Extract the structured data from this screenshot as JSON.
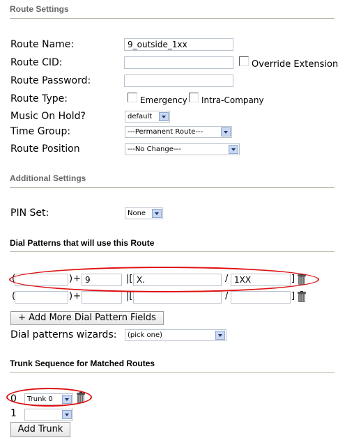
{
  "route_settings": {
    "heading": "Route Settings",
    "route_name_label": "Route Name:",
    "route_name_value": "9_outside_1xx",
    "route_cid_label": "Route CID:",
    "override_extension_label": "Override Extension",
    "route_password_label": "Route Password:",
    "route_type_label": "Route Type:",
    "emergency_label": "Emergency",
    "intra_company_label": "Intra-Company",
    "music_on_hold_label": "Music On Hold?",
    "music_on_hold_value": "default",
    "time_group_label": "Time Group:",
    "time_group_value": "---Permanent Route---",
    "route_position_label": "Route Position",
    "route_position_value": "---No Change---"
  },
  "additional_settings": {
    "heading": "Additional Settings",
    "pin_set_label": "PIN Set:",
    "pin_set_value": "None"
  },
  "dial_patterns": {
    "heading": "Dial Patterns that will use this Route",
    "rows": [
      {
        "prepend": "",
        "prefix": "9",
        "match": "X.",
        "callerid": "1XX"
      },
      {
        "prepend": "",
        "prefix": "",
        "match": "",
        "callerid": ""
      }
    ],
    "plus_sign": "+",
    "pipe_bracket": "|[",
    "slash": "/",
    "close_bracket": "]",
    "open_paren": "(",
    "close_paren": ")",
    "add_more_button": "+ Add More Dial Pattern Fields",
    "wizards_label": "Dial patterns wizards:",
    "wizards_value": "(pick one)"
  },
  "trunk_sequence": {
    "heading": "Trunk Sequence for Matched Routes",
    "rows": [
      {
        "index": "0",
        "trunk": "Trunk 0"
      },
      {
        "index": "1",
        "trunk": ""
      }
    ],
    "add_trunk_button": "Add Trunk"
  },
  "colors": {
    "annotation": "#e01010",
    "rule": "#b8b8a8"
  }
}
